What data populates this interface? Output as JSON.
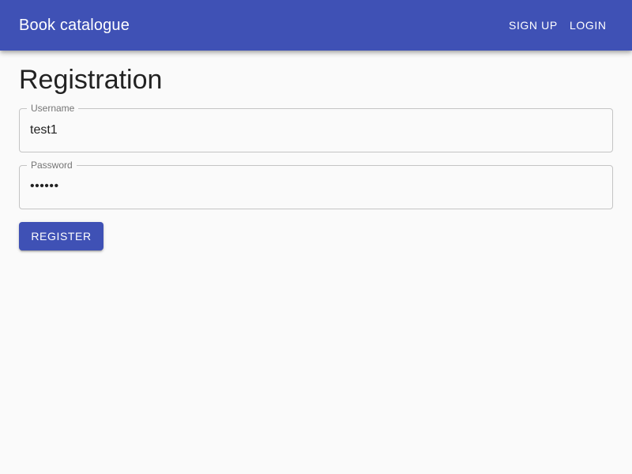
{
  "appbar": {
    "title": "Book catalogue",
    "nav": {
      "signup_label": "SIGN UP",
      "login_label": "LOGIN"
    }
  },
  "page": {
    "title": "Registration"
  },
  "form": {
    "username": {
      "label": "Username",
      "value": "test1"
    },
    "password": {
      "label": "Password",
      "value": "••••••"
    },
    "submit_label": "REGISTER"
  },
  "colors": {
    "primary": "#3f51b5",
    "background": "#fafafa",
    "text": "#222222",
    "border": "#c4c4c4",
    "label": "#757575"
  }
}
